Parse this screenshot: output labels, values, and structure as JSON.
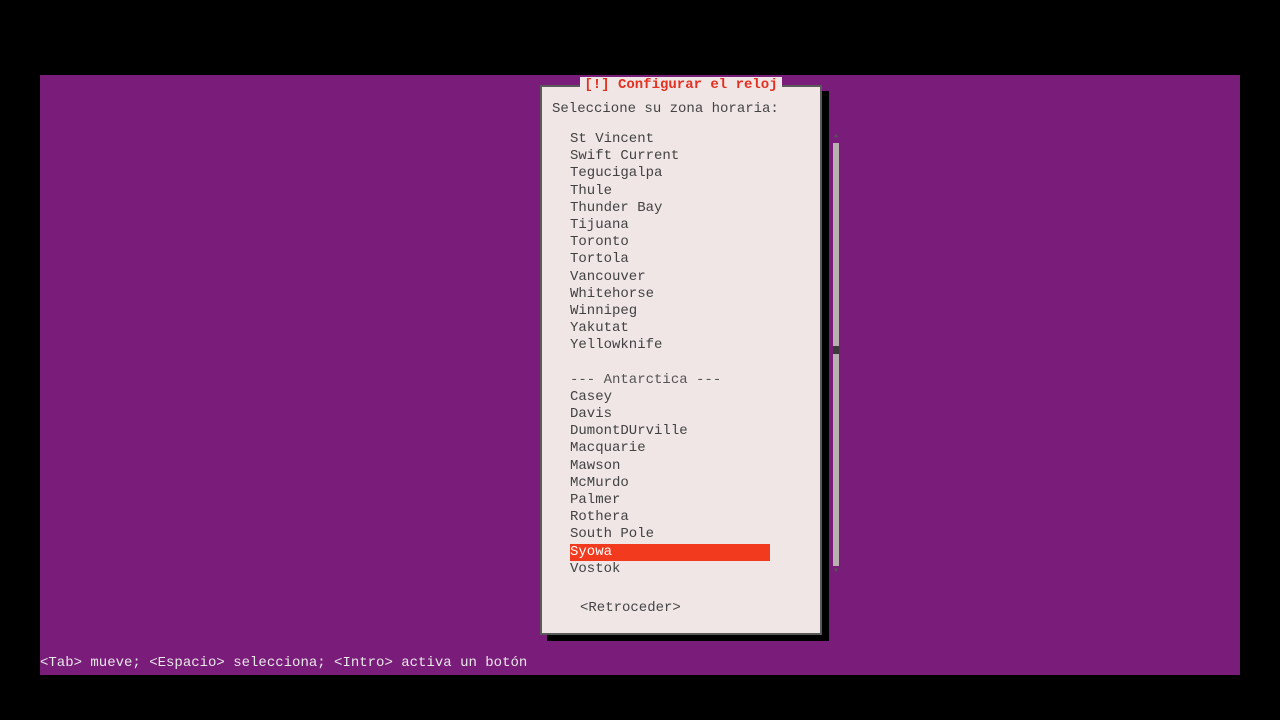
{
  "dialog": {
    "title": "[!] Configurar el reloj",
    "prompt": "Seleccione su zona horaria:",
    "back_label": "<Retroceder>",
    "selected_index": 24,
    "items": [
      "St Vincent",
      "Swift Current",
      "Tegucigalpa",
      "Thule",
      "Thunder Bay",
      "Tijuana",
      "Toronto",
      "Tortola",
      "Vancouver",
      "Whitehorse",
      "Winnipeg",
      "Yakutat",
      "Yellowknife",
      "",
      "--- Antarctica ---",
      "Casey",
      "Davis",
      "DumontDUrville",
      "Macquarie",
      "Mawson",
      "McMurdo",
      "Palmer",
      "Rothera",
      "South Pole",
      "Syowa",
      "Vostok"
    ],
    "scroll": {
      "top_glyph": "▴",
      "bottom_glyph": "▾",
      "thumb_pct": 48
    }
  },
  "helpbar": "<Tab> mueve; <Espacio> selecciona; <Intro> activa un botón"
}
